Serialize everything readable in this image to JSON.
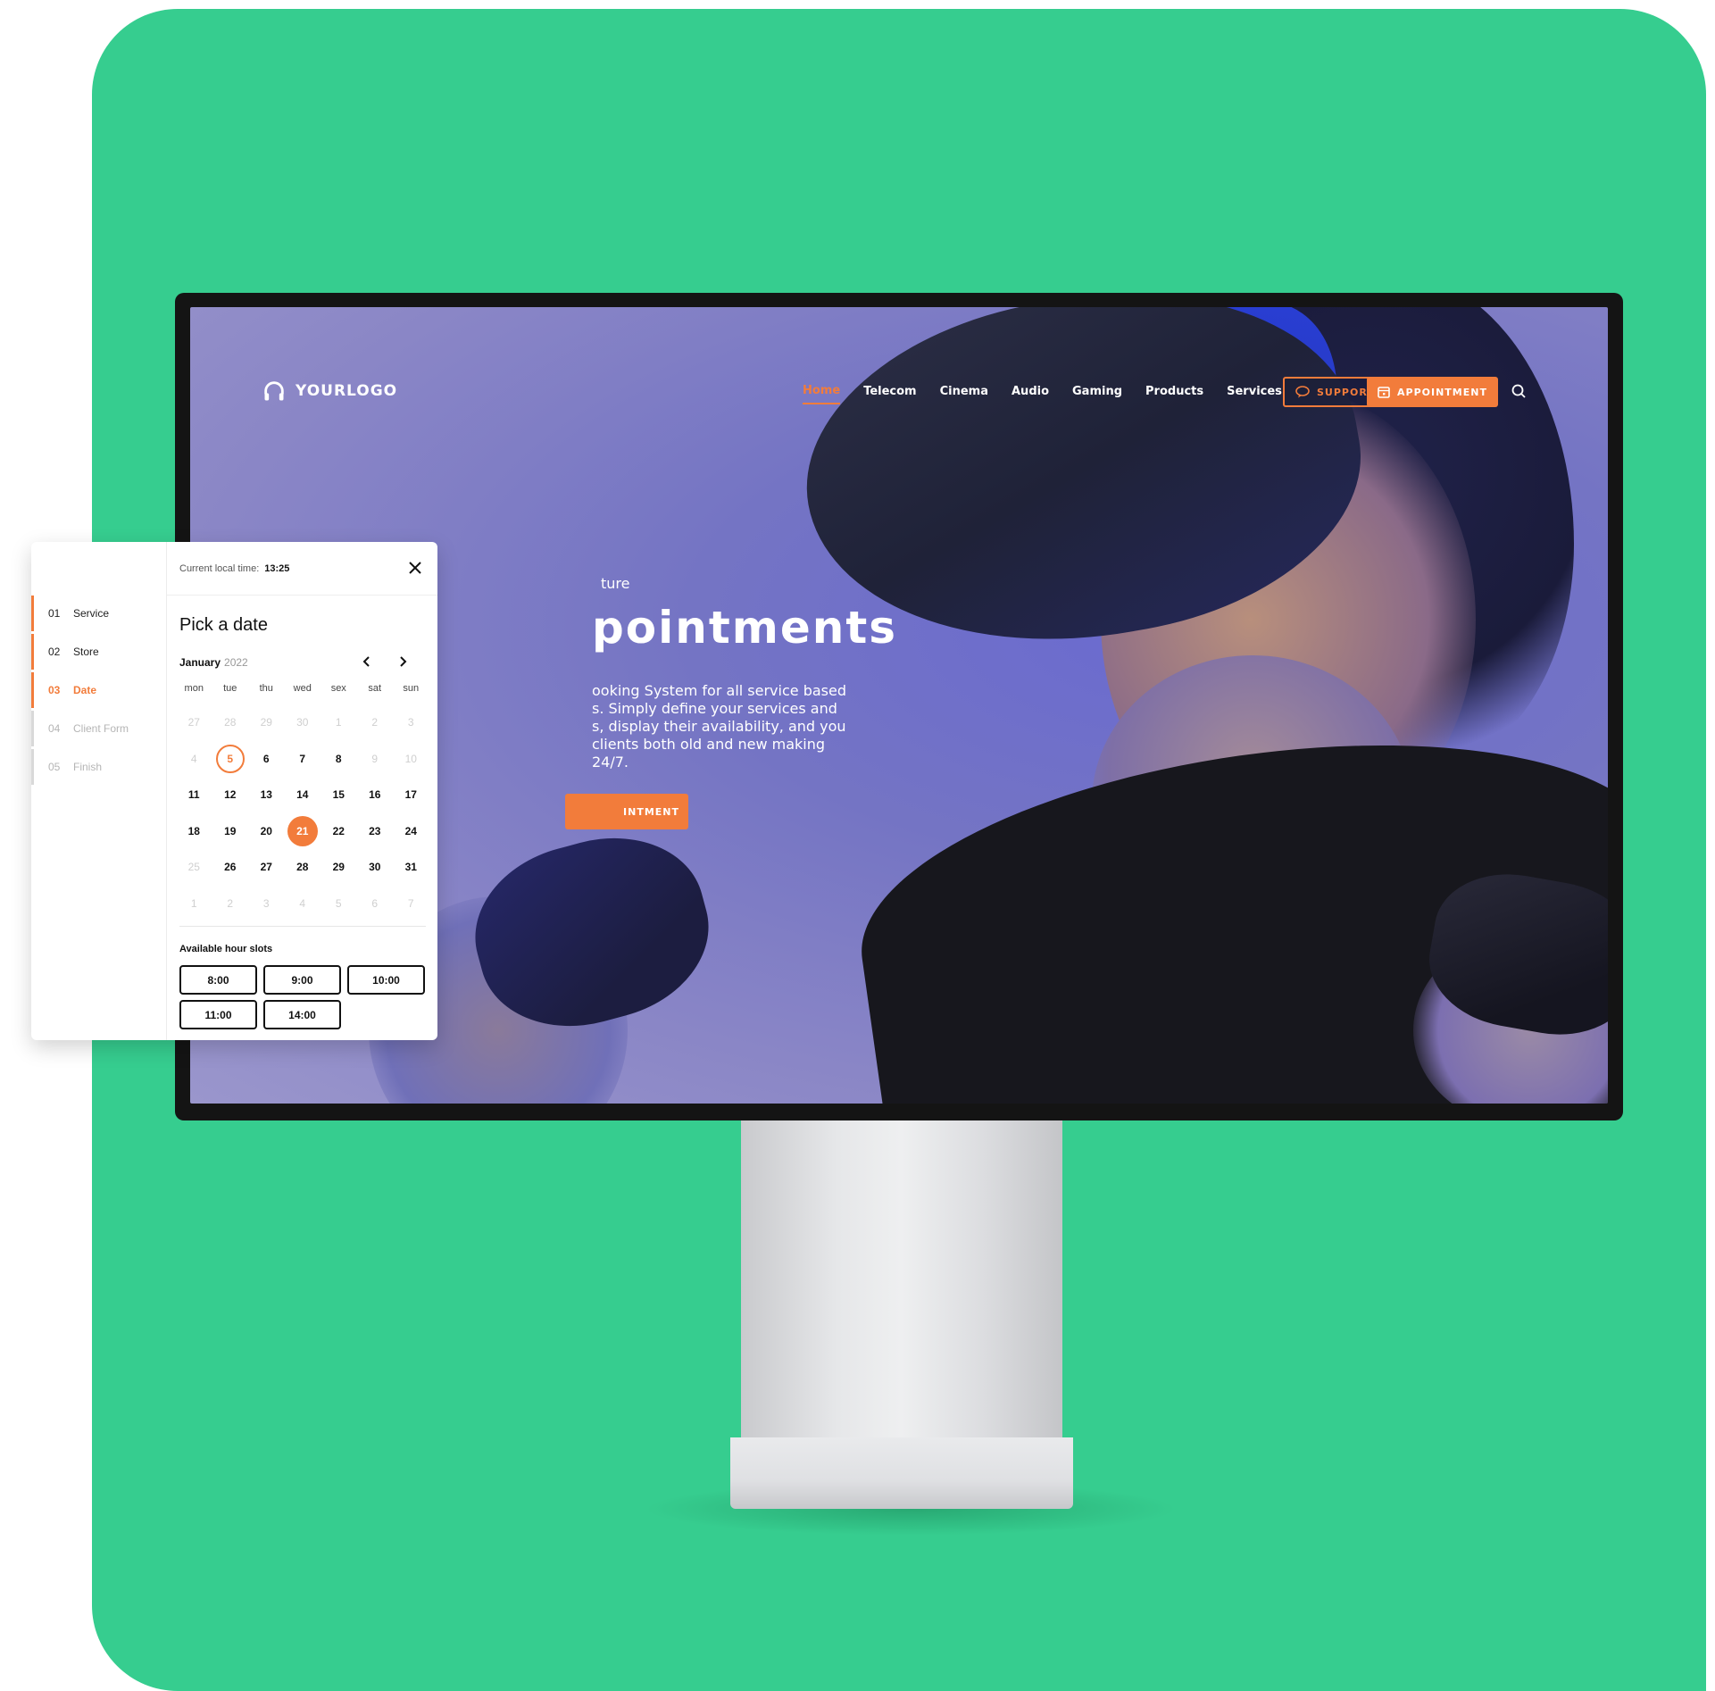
{
  "screen": {
    "brand": {
      "logo_text": "YOURLOGO",
      "icon": "headphones-icon"
    },
    "nav": {
      "items": [
        "Home",
        "Telecom",
        "Cinema",
        "Audio",
        "Gaming",
        "Products",
        "Services"
      ],
      "active": "Home",
      "support_label": "SUPPORT",
      "appointment_label": "APPOINTMENT",
      "search_icon": "search-icon"
    },
    "hero": {
      "eyebrow": "ture",
      "title": "pointments",
      "description": "ooking System for all service based\ns. Simply define your services and\ns, display their availability, and you\nclients both old and new making\n24/7.",
      "cta_label": "INTMENT"
    }
  },
  "booking": {
    "steps": [
      {
        "num": "01",
        "label": "Service",
        "state": "done"
      },
      {
        "num": "02",
        "label": "Store",
        "state": "done"
      },
      {
        "num": "03",
        "label": "Date",
        "state": "current"
      },
      {
        "num": "04",
        "label": "Client Form",
        "state": "todo"
      },
      {
        "num": "05",
        "label": "Finish",
        "state": "todo"
      }
    ],
    "time_label": "Current local time:",
    "time_value": "13:25",
    "title": "Pick a date",
    "month": "January",
    "year": "2022",
    "weekdays": [
      "mon",
      "tue",
      "thu",
      "wed",
      "sex",
      "sat",
      "sun"
    ],
    "weeks": [
      [
        [
          "27",
          "muted"
        ],
        [
          "28",
          "muted"
        ],
        [
          "29",
          "muted"
        ],
        [
          "30",
          "muted"
        ],
        [
          "1",
          "muted"
        ],
        [
          "2",
          "muted"
        ],
        [
          "3",
          "muted"
        ]
      ],
      [
        [
          "4",
          "muted"
        ],
        [
          "5",
          "today"
        ],
        [
          "6",
          ""
        ],
        [
          "7",
          ""
        ],
        [
          "8",
          ""
        ],
        [
          "9",
          "muted"
        ],
        [
          "10",
          "muted"
        ]
      ],
      [
        [
          "11",
          ""
        ],
        [
          "12",
          ""
        ],
        [
          "13",
          ""
        ],
        [
          "14",
          ""
        ],
        [
          "15",
          ""
        ],
        [
          "16",
          ""
        ],
        [
          "17",
          ""
        ]
      ],
      [
        [
          "18",
          ""
        ],
        [
          "19",
          ""
        ],
        [
          "20",
          ""
        ],
        [
          "21",
          "selected"
        ],
        [
          "22",
          ""
        ],
        [
          "23",
          ""
        ],
        [
          "24",
          ""
        ]
      ],
      [
        [
          "25",
          "muted"
        ],
        [
          "26",
          ""
        ],
        [
          "27",
          ""
        ],
        [
          "28",
          ""
        ],
        [
          "29",
          ""
        ],
        [
          "30",
          ""
        ],
        [
          "31",
          ""
        ]
      ],
      [
        [
          "1",
          "muted"
        ],
        [
          "2",
          "muted"
        ],
        [
          "3",
          "muted"
        ],
        [
          "4",
          "muted"
        ],
        [
          "5",
          "muted"
        ],
        [
          "6",
          "muted"
        ],
        [
          "7",
          "muted"
        ]
      ]
    ],
    "slots_title": "Available hour slots",
    "slots": [
      "8:00",
      "9:00",
      "10:00",
      "11:00",
      "14:00"
    ]
  },
  "colors": {
    "background": "#36cd8f",
    "accent": "#f27c3b"
  }
}
